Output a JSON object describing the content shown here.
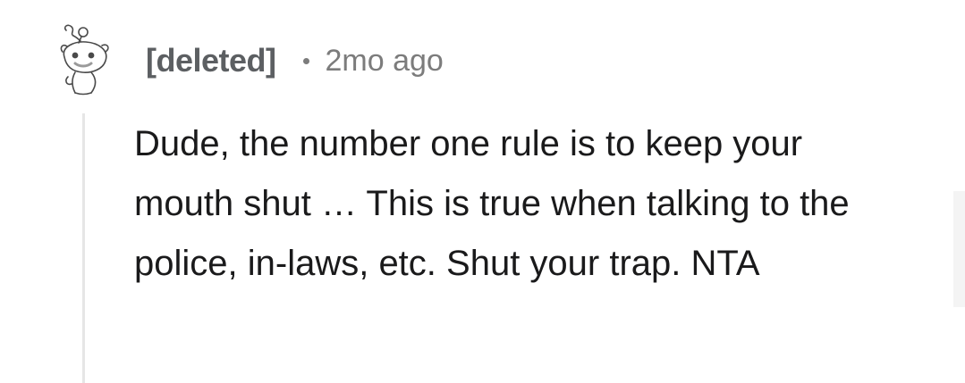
{
  "comment": {
    "author": "[deleted]",
    "timestamp": "2mo ago",
    "avatar_icon": "snoo-sketch-icon",
    "body": "Dude, the number one rule is to keep your mouth shut … This is true when talking to the police, in-laws, etc. Shut your trap. NTA"
  },
  "colors": {
    "author": "#5c5f62",
    "meta": "#7c7c7c",
    "body_text": "#1a1a1b",
    "thread_line": "#e6e6e6"
  }
}
